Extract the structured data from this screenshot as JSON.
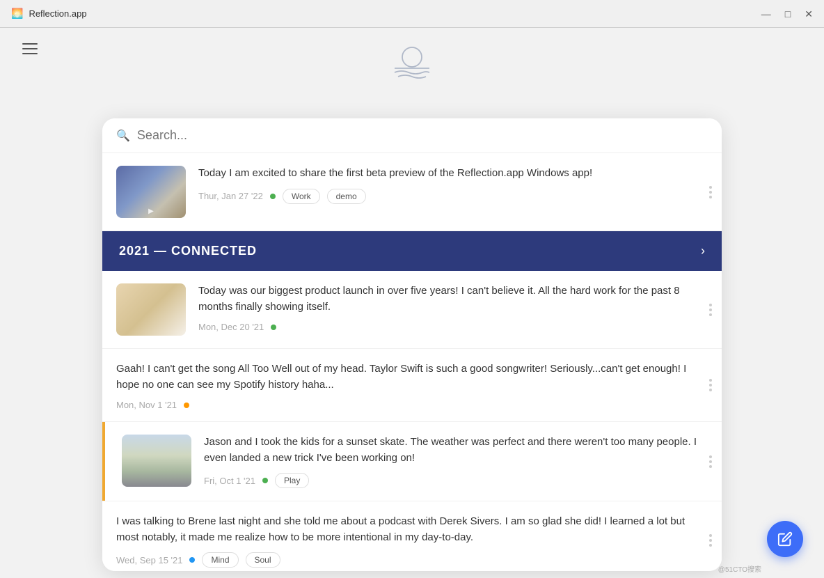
{
  "titlebar": {
    "app_name": "Reflection.app",
    "icon": "🌅",
    "controls": {
      "minimize": "—",
      "maximize": "□",
      "close": "✕"
    }
  },
  "header": {
    "logo_title": "Reflection App Logo"
  },
  "search": {
    "placeholder": "Search..."
  },
  "section_header": {
    "title": "2021 — CONNECTED",
    "chevron": "›"
  },
  "entries": [
    {
      "id": "entry-1",
      "text": "Today I am excited to share the first beta preview of the Reflection.app Windows app!",
      "date": "Thur, Jan 27 '22",
      "dot_color": "green",
      "tags": [
        "Work",
        "demo"
      ],
      "has_image": true,
      "thumb_class": "thumb-1"
    },
    {
      "id": "entry-2",
      "text": "Today was our biggest product launch in over five years! I can't believe it. All the hard work for the past 8 months finally showing itself.",
      "date": "Mon, Dec 20 '21",
      "dot_color": "green",
      "tags": [],
      "has_image": true,
      "thumb_class": "thumb-2"
    },
    {
      "id": "entry-3",
      "text": "Gaah! I can't get the song All Too Well out of my head. Taylor Swift is such a good songwriter! Seriously...can't get enough! I hope no one can see my Spotify history haha...",
      "date": "Mon, Nov 1 '21",
      "dot_color": "orange",
      "tags": [],
      "has_image": false
    },
    {
      "id": "entry-4",
      "text": "Jason and I took the kids for a sunset skate. The weather was perfect and there weren't too many people. I even landed a new trick I've been working on!",
      "date": "Fri, Oct 1 '21",
      "dot_color": "green",
      "tags": [
        "Play"
      ],
      "has_image": true,
      "thumb_class": "thumb-3"
    },
    {
      "id": "entry-5",
      "text": "I was talking to Brene last night and she told me about a podcast with Derek Sivers. I am so glad she did! I learned a lot but most notably, it made me realize how to be more intentional in my day-to-day.",
      "date": "Wed, Sep 15 '21",
      "dot_color": "blue",
      "tags": [
        "Mind",
        "Soul"
      ],
      "has_image": false
    }
  ],
  "fab": {
    "label": "Edit/Write"
  },
  "watermark": "@51CTO搜索"
}
